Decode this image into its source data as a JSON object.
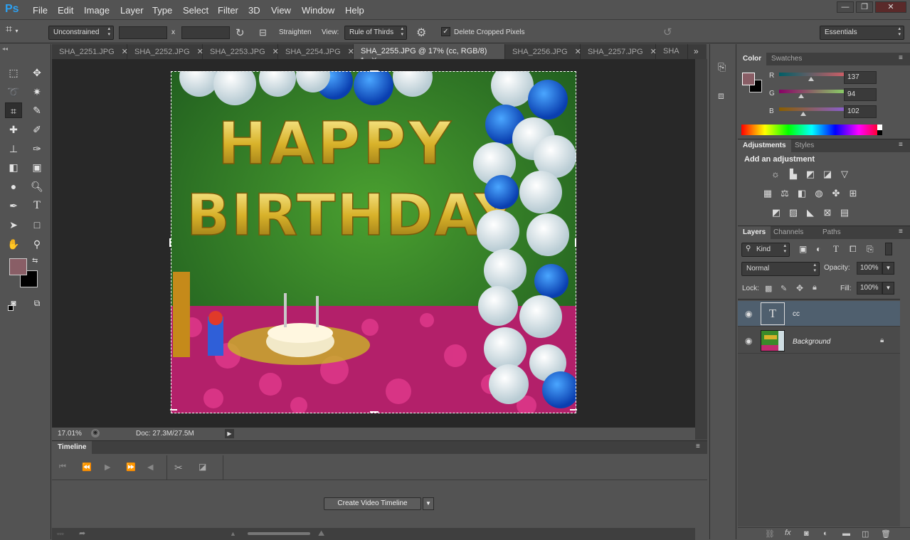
{
  "app": {
    "logo": "Ps"
  },
  "menu": [
    "File",
    "Edit",
    "Image",
    "Layer",
    "Type",
    "Select",
    "Filter",
    "3D",
    "View",
    "Window",
    "Help"
  ],
  "window_controls": {
    "minimize": "—",
    "restore": "❐",
    "close": "✕"
  },
  "options": {
    "ratio": "Unconstrained",
    "x_sep": "x",
    "straighten": "Straighten",
    "view_label": "View:",
    "view_value": "Rule of Thirds",
    "delete_cropped": "Delete Cropped Pixels",
    "delete_cropped_checked": true,
    "workspace": "Essentials"
  },
  "doc_tabs": [
    {
      "label": "SHA_2251.JPG",
      "active": false
    },
    {
      "label": "SHA_2252.JPG",
      "active": false
    },
    {
      "label": "SHA_2253.JPG",
      "active": false
    },
    {
      "label": "SHA_2254.JPG",
      "active": false
    },
    {
      "label": "SHA_2255.JPG @ 17% (cc, RGB/8) *",
      "active": true
    },
    {
      "label": "SHA_2256.JPG",
      "active": false
    },
    {
      "label": "SHA_2257.JPG",
      "active": false
    },
    {
      "label": "SHA",
      "active": false
    }
  ],
  "tab_close": "✕",
  "tab_overflow": "»",
  "photo": {
    "line1": "HAPPY",
    "line2": "BIRTHDAY"
  },
  "status": {
    "zoom": "17.01%",
    "doc": "Doc: 27.3M/27.5M"
  },
  "timeline": {
    "title": "Timeline",
    "create_button": "Create Video Timeline"
  },
  "color_panel": {
    "tabs": [
      "Color",
      "Swatches"
    ],
    "foreground": "#895e66",
    "background": "#000000",
    "channels": [
      {
        "name": "R",
        "value": "137"
      },
      {
        "name": "G",
        "value": "94"
      },
      {
        "name": "B",
        "value": "102"
      }
    ]
  },
  "adjustments_panel": {
    "tabs": [
      "Adjustments",
      "Styles"
    ],
    "heading": "Add an adjustment"
  },
  "layers_panel": {
    "tabs": [
      "Layers",
      "Channels",
      "Paths"
    ],
    "filter_kind": "Kind",
    "blend_mode": "Normal",
    "opacity_label": "Opacity:",
    "opacity": "100%",
    "lock_label": "Lock:",
    "fill_label": "Fill:",
    "fill": "100%",
    "layers": [
      {
        "name": "cc",
        "type": "text",
        "selected": true
      },
      {
        "name": "Background",
        "type": "image",
        "locked": true
      }
    ]
  },
  "colors": {
    "accent": "#2da0f0",
    "selected_layer": "#4f5f6e"
  }
}
